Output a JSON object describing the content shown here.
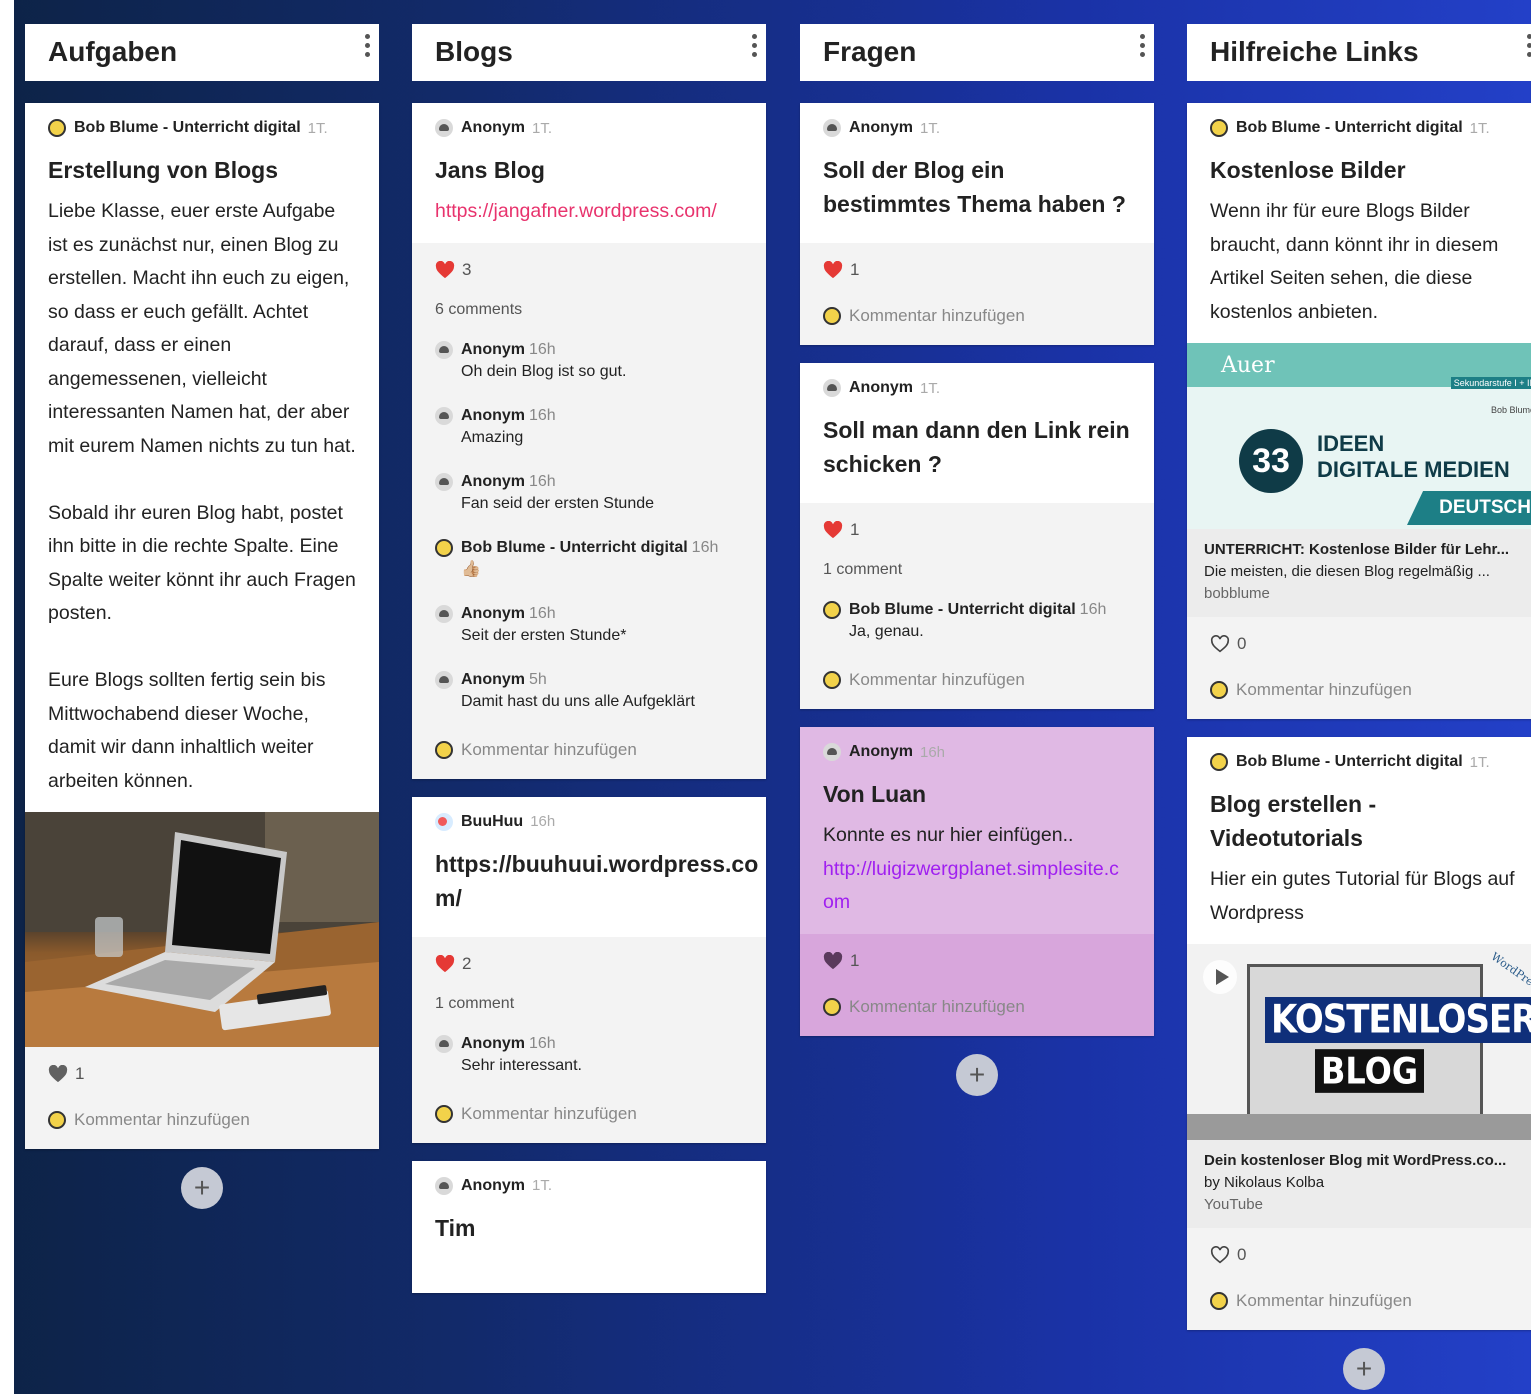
{
  "columns": [
    {
      "title": "Aufgaben",
      "cards": [
        {
          "author": "Bob Blume - Unterricht digital",
          "time": "1T.",
          "title": "Erstellung von Blogs",
          "body": "Liebe Klasse, euer erste Aufgabe ist es zunächst nur, einen Blog zu erstellen. Macht ihn euch zu eigen, so dass er euch gefällt. Achtet darauf, dass er einen angemessenen, vielleicht interessanten Namen hat, der aber mit eurem Namen nichts zu tun hat.\n\nSobald ihr euren Blog habt, postet ihn bitte in die rechte Spalte. Eine Spalte weiter könnt ihr auch Fragen posten.\n\nEure Blogs sollten fertig sein bis Mittwochabend dieser Woche, damit wir dann inhaltlich weiter arbeiten können.",
          "likes": "1",
          "add_comment": "Kommentar hinzufügen"
        }
      ]
    },
    {
      "title": "Blogs",
      "cards": [
        {
          "author": "Anonym",
          "time": "1T.",
          "title": "Jans Blog",
          "link": "https://jangafner.wordpress.com/",
          "likes": "3",
          "comments_count": "6 comments",
          "comments": [
            {
              "author": "Anonym",
              "time": "16h",
              "text": "Oh dein Blog ist so gut."
            },
            {
              "author": "Anonym",
              "time": "16h",
              "text": "Amazing"
            },
            {
              "author": "Anonym",
              "time": "16h",
              "text": "Fan seid der ersten Stunde"
            },
            {
              "author": "Bob Blume - Unterricht digital",
              "time": "16h",
              "text": "👍🏼"
            },
            {
              "author": "Anonym",
              "time": "16h",
              "text": "Seit der ersten Stunde*"
            },
            {
              "author": "Anonym",
              "time": "5h",
              "text": "Damit hast du uns alle Aufgeklärt"
            }
          ],
          "add_comment": "Kommentar hinzufügen"
        },
        {
          "author": "BuuHuu",
          "time": "16h",
          "title": "https://buuhuui.wordpress.co m/",
          "likes": "2",
          "comments_count": "1 comment",
          "comments": [
            {
              "author": "Anonym",
              "time": "16h",
              "text": "Sehr interessant."
            }
          ],
          "add_comment": "Kommentar hinzufügen"
        },
        {
          "author": "Anonym",
          "time": "1T.",
          "title": "Tim"
        }
      ]
    },
    {
      "title": "Fragen",
      "cards": [
        {
          "author": "Anonym",
          "time": "1T.",
          "title": "Soll der Blog ein bestimmtes Thema haben ?",
          "likes": "1",
          "add_comment": "Kommentar hinzufügen"
        },
        {
          "author": "Anonym",
          "time": "1T.",
          "title": "Soll man dann den Link rein schicken ?",
          "likes": "1",
          "comments_count": "1 comment",
          "comments": [
            {
              "author": "Bob Blume - Unterricht digital",
              "time": "16h",
              "text": "Ja, genau."
            }
          ],
          "add_comment": "Kommentar hinzufügen"
        },
        {
          "author": "Anonym",
          "time": "16h",
          "title": "Von Luan",
          "body": "Konnte es nur hier einfügen..",
          "link": "http://luigizwergplanet.simplesite.c om",
          "likes": "1",
          "add_comment": "Kommentar hinzufügen",
          "color": "#e0b9e4"
        }
      ]
    },
    {
      "title": "Hilfreiche Links",
      "cards": [
        {
          "author": "Bob Blume - Unterricht digital",
          "time": "1T.",
          "title": "Kostenlose Bilder",
          "body": "Wenn ihr für eure Blogs Bilder braucht, dann könnt ihr in diesem Artikel Seiten sehen, die diese kostenlos anbieten.",
          "preview": {
            "brand": "Auer",
            "level": "Sekundarstufe I + II",
            "author": "Bob Blume",
            "number": "33",
            "line1": "IDEEN",
            "line2": "DIGITALE MEDIEN",
            "subject": "DEUTSCH"
          },
          "preview_title": "UNTERRICHT: Kostenlose Bilder für Lehr...",
          "preview_desc": "Die meisten, die diesen Blog regelmäßig ...",
          "preview_source": "bobblume",
          "likes": "0",
          "add_comment": "Kommentar hinzufügen"
        },
        {
          "author": "Bob Blume - Unterricht digital",
          "time": "1T.",
          "title": "Blog erstellen - Videotutorials",
          "body": "Hier ein gutes Tutorial für Blogs auf Wordpress",
          "video": {
            "line1": "KOSTENLOSER",
            "line2": "BLOG",
            "mark": "WordPress"
          },
          "preview_title": "Dein kostenloser Blog mit WordPress.co...",
          "preview_desc": "by Nikolaus Kolba",
          "preview_source": "YouTube",
          "likes": "0",
          "add_comment": "Kommentar hinzufügen"
        }
      ]
    }
  ],
  "add_button": "+",
  "colors": {
    "heart_red": "#e53935",
    "link_pink": "#e8336d",
    "link_purple": "#a020f0",
    "purple_card": "#e0b9e4"
  }
}
